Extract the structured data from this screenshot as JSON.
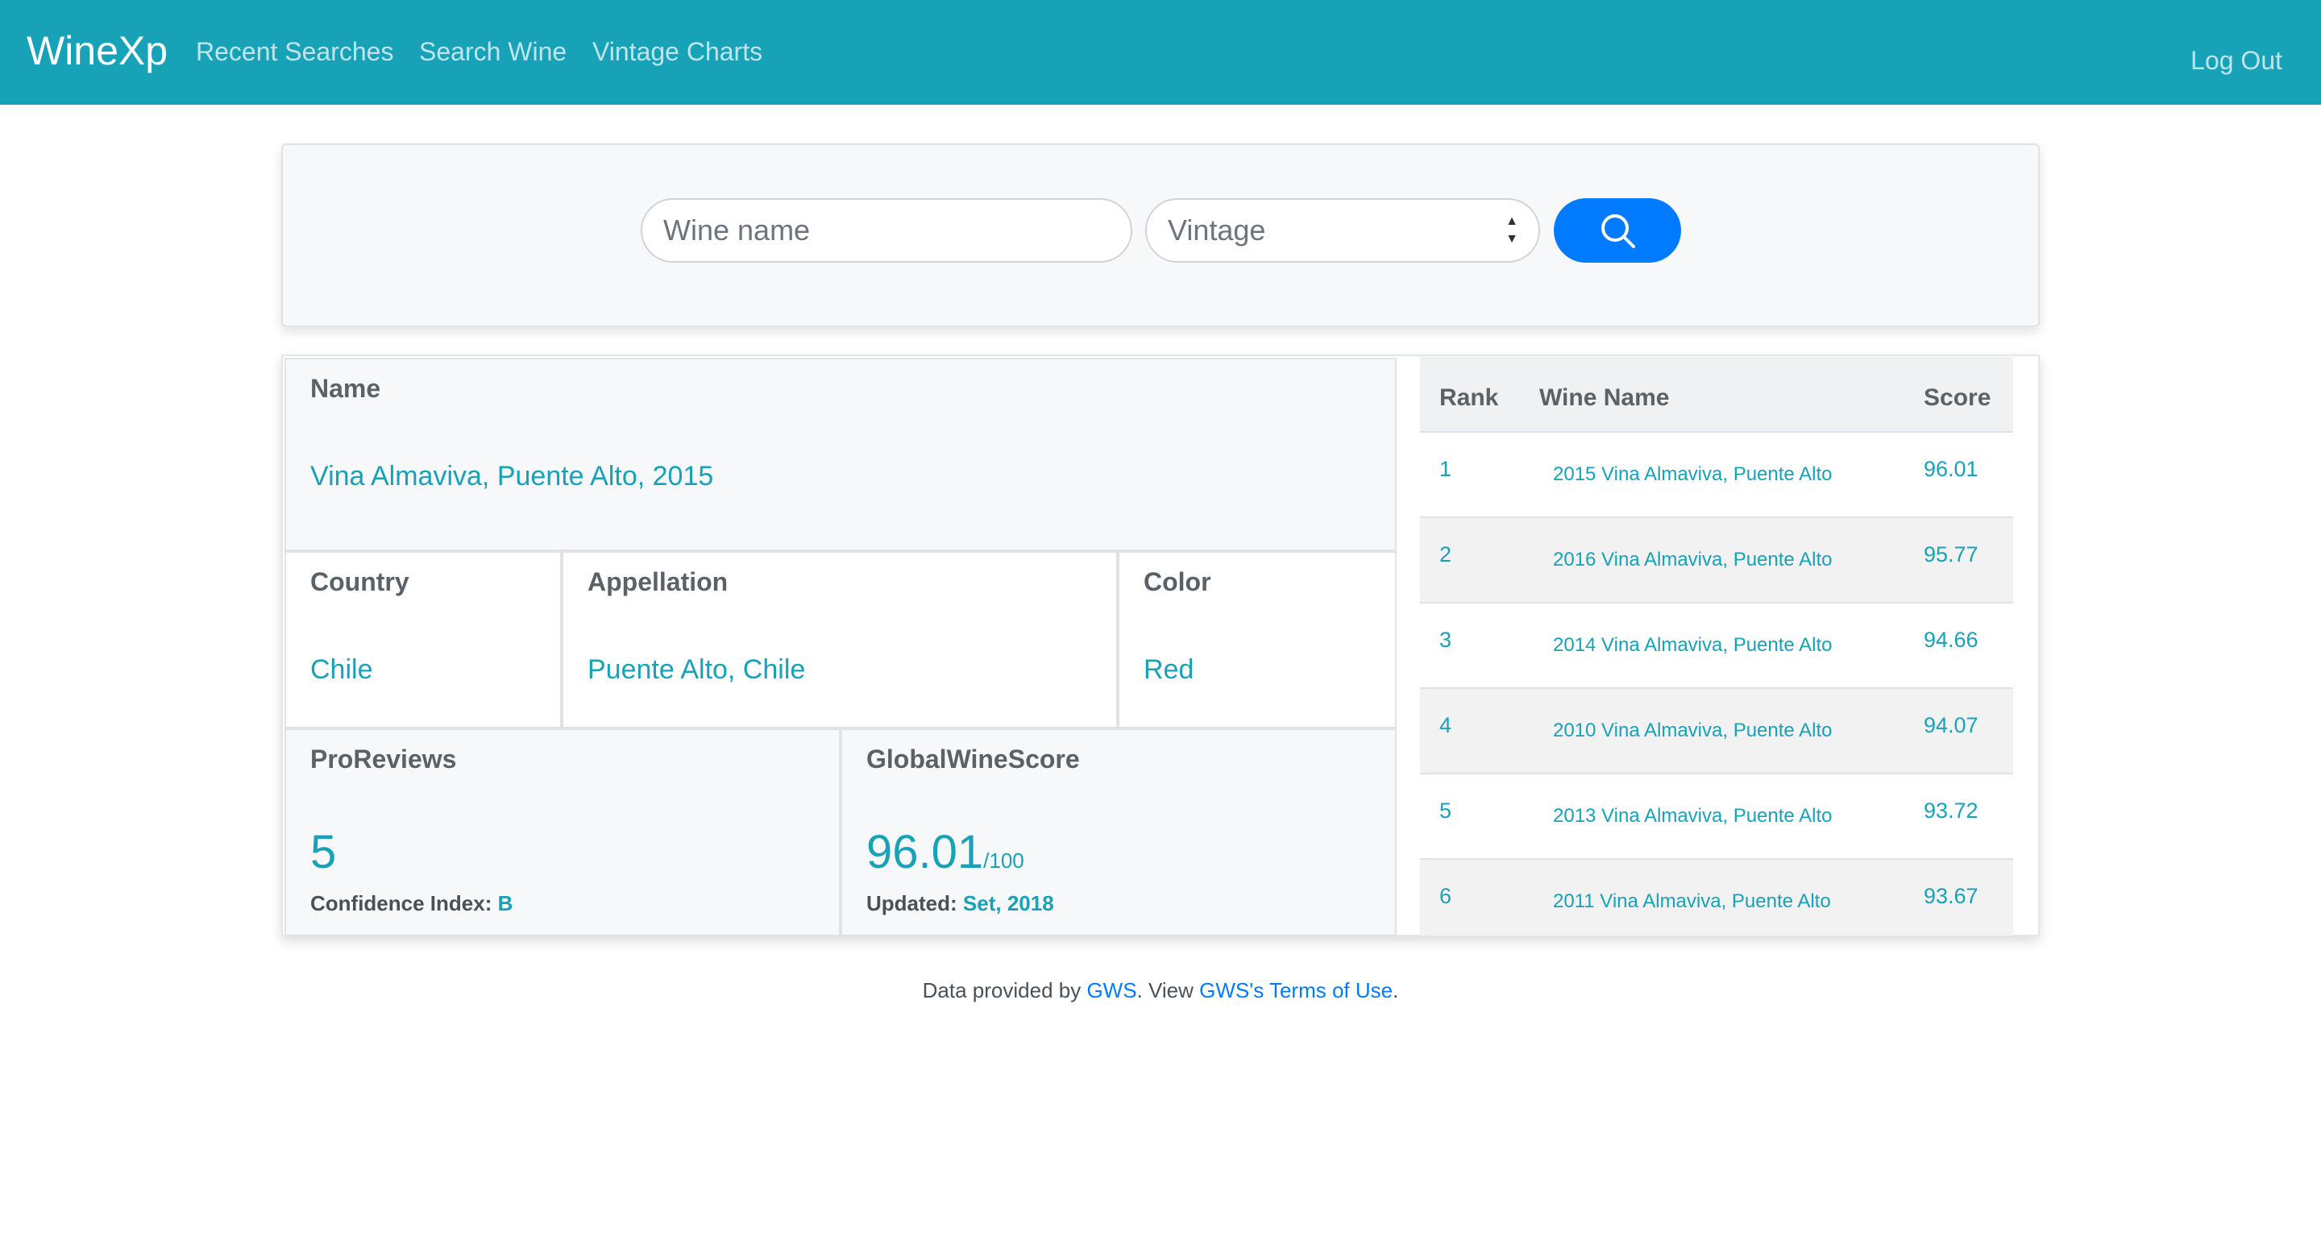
{
  "nav": {
    "brand": "WineXp",
    "links": [
      "Recent Searches",
      "Search Wine",
      "Vintage Charts"
    ],
    "logout": "Log Out"
  },
  "search": {
    "wine_name_placeholder": "Wine name",
    "vintage_placeholder": "Vintage",
    "button_icon": "search-icon"
  },
  "details": {
    "name_label": "Name",
    "name_value": "Vina Almaviva, Puente Alto, 2015",
    "country_label": "Country",
    "country_value": "Chile",
    "appellation_label": "Appellation",
    "appellation_value": "Puente Alto, Chile",
    "color_label": "Color",
    "color_value": "Red",
    "proreviews_label": "ProReviews",
    "proreviews_value": "5",
    "confidence_label": "Confidence Index:",
    "confidence_value": "B",
    "gws_label": "GlobalWineScore",
    "gws_value": "96.01",
    "gws_scale": "/100",
    "updated_label": "Updated:",
    "updated_value": "Set, 2018"
  },
  "ranking": {
    "headers": {
      "rank": "Rank",
      "name": "Wine Name",
      "score": "Score"
    },
    "rows": [
      {
        "rank": "1",
        "name": "2015 Vina Almaviva, Puente Alto",
        "score": "96.01"
      },
      {
        "rank": "2",
        "name": "2016 Vina Almaviva, Puente Alto",
        "score": "95.77"
      },
      {
        "rank": "3",
        "name": "2014 Vina Almaviva, Puente Alto",
        "score": "94.66"
      },
      {
        "rank": "4",
        "name": "2010 Vina Almaviva, Puente Alto",
        "score": "94.07"
      },
      {
        "rank": "5",
        "name": "2013 Vina Almaviva, Puente Alto",
        "score": "93.72"
      },
      {
        "rank": "6",
        "name": "2011 Vina Almaviva, Puente Alto",
        "score": "93.67"
      }
    ]
  },
  "footer": {
    "prefix": "Data provided by",
    "gws_link": "GWS",
    "middle": ". View",
    "terms_link": "GWS's Terms of Use",
    "suffix": "."
  },
  "colors": {
    "navbar": "#17a2b8",
    "accent": "#17a2b8",
    "primary": "#007bff"
  }
}
